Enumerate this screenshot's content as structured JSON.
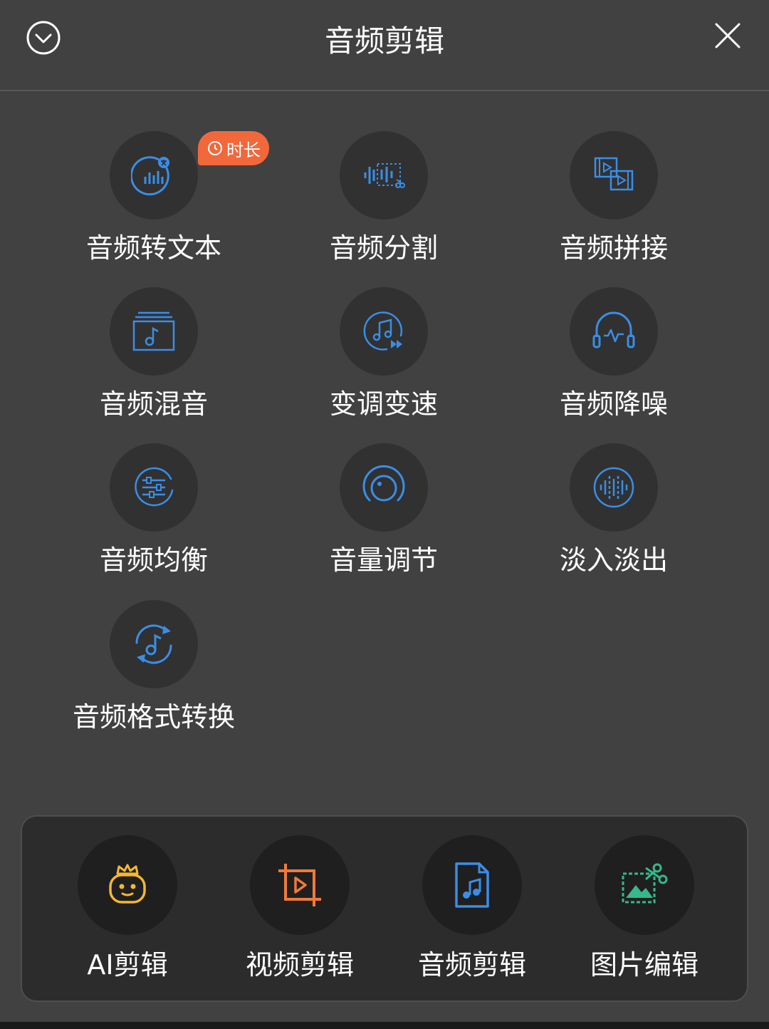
{
  "header": {
    "title": "音频剪辑",
    "collapse_icon": "chevron-down-circle-icon",
    "close_icon": "close-icon"
  },
  "tools": [
    {
      "label": "音频转文本",
      "icon": "audio-to-text-icon",
      "badge": "时长"
    },
    {
      "label": "音频分割",
      "icon": "audio-split-icon"
    },
    {
      "label": "音频拼接",
      "icon": "audio-join-icon"
    },
    {
      "label": "音频混音",
      "icon": "audio-mix-icon"
    },
    {
      "label": "变调变速",
      "icon": "pitch-speed-icon"
    },
    {
      "label": "音频降噪",
      "icon": "noise-reduction-icon"
    },
    {
      "label": "音频均衡",
      "icon": "equalizer-icon"
    },
    {
      "label": "音量调节",
      "icon": "volume-knob-icon"
    },
    {
      "label": "淡入淡出",
      "icon": "fade-icon"
    },
    {
      "label": "音频格式转换",
      "icon": "format-convert-icon"
    }
  ],
  "dock": [
    {
      "label": "AI剪辑",
      "icon": "ai-robot-icon",
      "color": "#f5b731"
    },
    {
      "label": "视频剪辑",
      "icon": "video-crop-icon",
      "color": "#f07a3a"
    },
    {
      "label": "音频剪辑",
      "icon": "audio-file-icon",
      "color": "#3a8ee6"
    },
    {
      "label": "图片编辑",
      "icon": "image-cut-icon",
      "color": "#35b88a"
    }
  ],
  "colors": {
    "background": "#414142",
    "accent_blue": "#3a8ee6",
    "badge": "#f2683b"
  }
}
